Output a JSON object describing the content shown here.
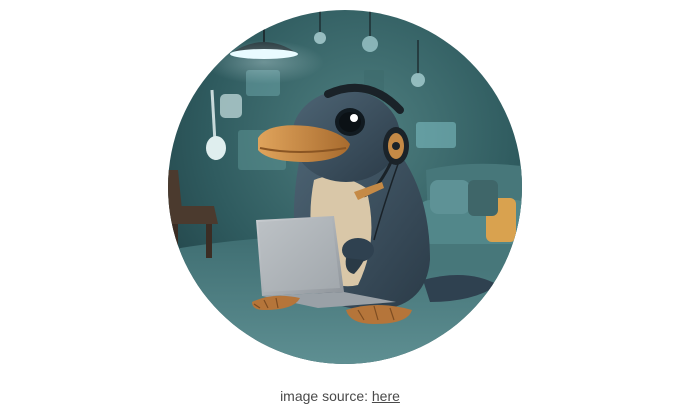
{
  "image": {
    "subject": "platypus-with-headset-and-laptop"
  },
  "caption": {
    "prefix": "image source: ",
    "link_text": "here"
  },
  "colors": {
    "background": "#ffffff",
    "caption_text": "#4a4a4a",
    "scene_teal": "#2f5b5f",
    "platypus_body": "#3a4e5c",
    "bill": "#c98a43"
  }
}
